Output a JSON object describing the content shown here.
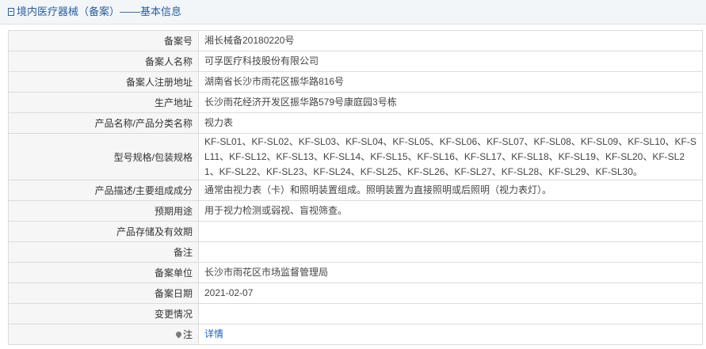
{
  "header": {
    "title": "境内医疗器械（备案）——基本信息",
    "icon": "document-icon"
  },
  "rows": [
    {
      "label": "备案号",
      "value": "湘长械备20180220号"
    },
    {
      "label": "备案人名称",
      "value": "可孚医疗科技股份有限公司"
    },
    {
      "label": "备案人注册地址",
      "value": "湖南省长沙市雨花区振华路816号"
    },
    {
      "label": "生产地址",
      "value": "长沙雨花经济开发区振华路579号康庭园3号栋"
    },
    {
      "label": "产品名称/产品分类名称",
      "value": "视力表"
    },
    {
      "label": "型号规格/包装规格",
      "value": "KF-SL01、KF-SL02、KF-SL03、KF-SL04、KF-SL05、KF-SL06、KF-SL07、KF-SL08、KF-SL09、KF-SL10、KF-SL11、KF-SL12、KF-SL13、KF-SL14、KF-SL15、KF-SL16、KF-SL17、KF-SL18、KF-SL19、KF-SL20、KF-SL21、KF-SL22、KF-SL23、KF-SL24、KF-SL25、KF-SL26、KF-SL27、KF-SL28、KF-SL29、KF-SL30。"
    },
    {
      "label": "产品描述/主要组成成分",
      "value": "通常由视力表（卡）和照明装置组成。照明装置为直接照明或后照明（视力表灯）。"
    },
    {
      "label": "预期用途",
      "value": "用于视力检测或弱视、盲视筛查。"
    },
    {
      "label": "产品存储及有效期",
      "value": ""
    },
    {
      "label": "备注",
      "value": ""
    },
    {
      "label": "备案单位",
      "value": "长沙市雨花区市场监督管理局"
    },
    {
      "label": "备案日期",
      "value": "2021-02-07"
    },
    {
      "label": "变更情况",
      "value": ""
    },
    {
      "label": "注",
      "value": "详情",
      "icon": "pin-icon"
    }
  ]
}
